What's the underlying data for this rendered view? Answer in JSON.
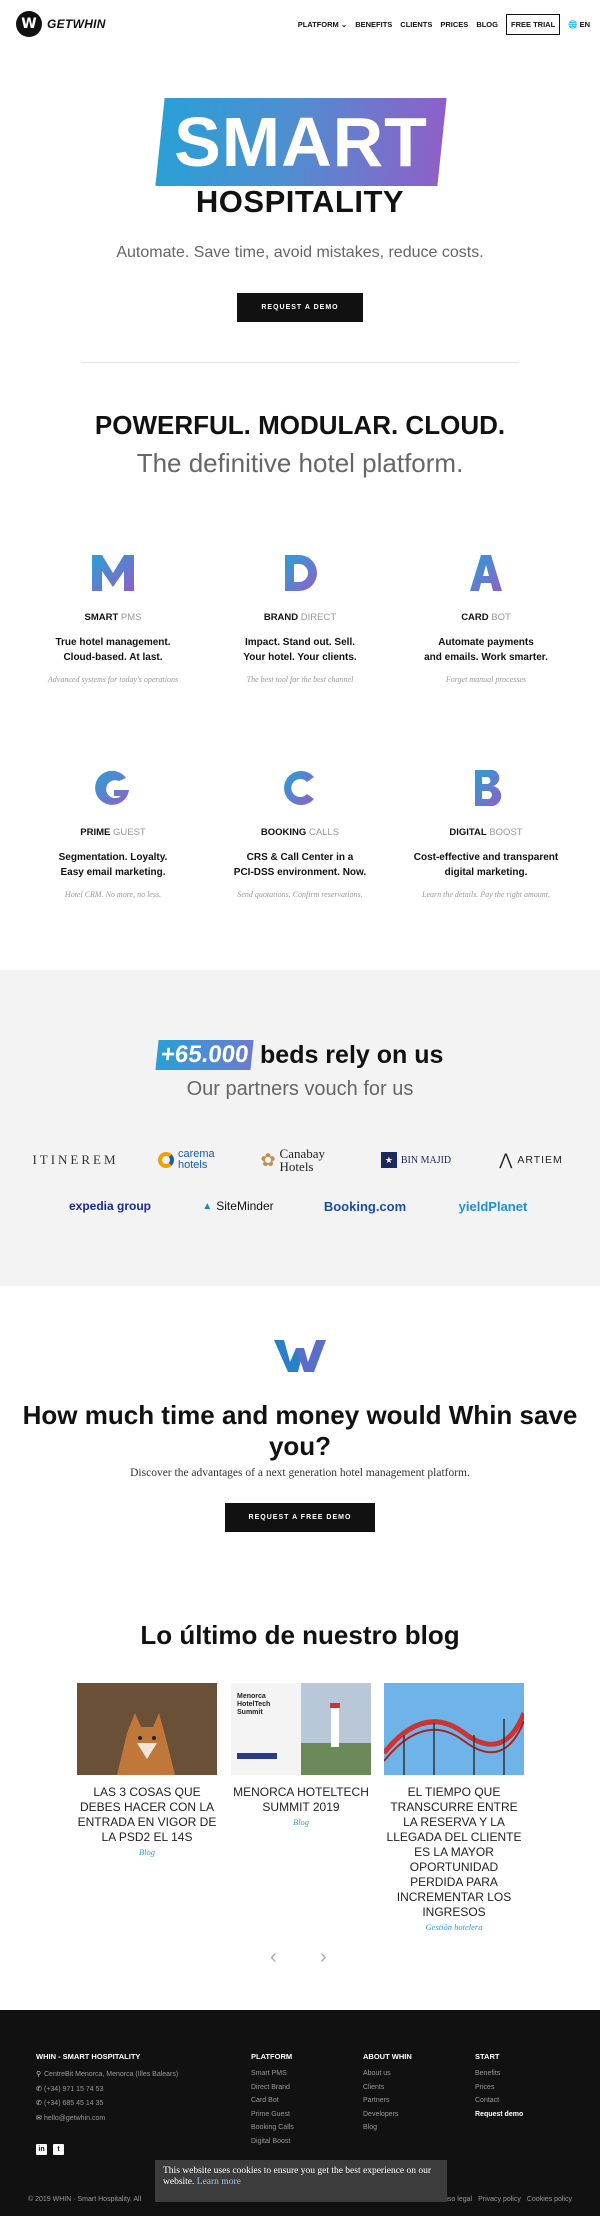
{
  "header": {
    "brand": "GETWHIN",
    "logo_letter": "W",
    "nav": [
      {
        "label": "PLATFORM ⌄"
      },
      {
        "label": "BENEFITS"
      },
      {
        "label": "CLIENTS"
      },
      {
        "label": "PRICES"
      },
      {
        "label": "BLOG"
      },
      {
        "label": "FREE TRIAL"
      },
      {
        "label": "🌐 EN"
      }
    ]
  },
  "hero": {
    "badge": "SMART",
    "title": "HOSPITALITY",
    "subtitle": "Automate. Save time, avoid mistakes, reduce costs.",
    "cta": "REQUEST A DEMO"
  },
  "platform": {
    "title": "POWERFUL. MODULAR. CLOUD.",
    "subtitle": "The definitive hotel platform."
  },
  "products": [
    {
      "letter": "M",
      "name": "SMART",
      "suffix": "PMS",
      "desc1": "True hotel management.",
      "desc2": "Cloud-based. At last.",
      "tagline": "Advanced systems for today's operations",
      "icon": "module-m-icon"
    },
    {
      "letter": "D",
      "name": "BRAND",
      "suffix": "DIRECT",
      "desc1": "Impact. Stand out. Sell.",
      "desc2": "Your hotel. Your clients.",
      "tagline": "The best tool for the best channel",
      "icon": "module-d-icon"
    },
    {
      "letter": "A",
      "name": "CARD",
      "suffix": "BOT",
      "desc1": "Automate payments",
      "desc2": "and emails. Work smarter.",
      "tagline": "Forget manual processes",
      "icon": "module-a-icon"
    },
    {
      "letter": "G",
      "name": "PRIME",
      "suffix": "GUEST",
      "desc1": "Segmentation. Loyalty.",
      "desc2": "Easy email marketing.",
      "tagline": "Hotel CRM. No more, no less.",
      "icon": "module-g-icon"
    },
    {
      "letter": "C",
      "name": "BOOKING",
      "suffix": "CALLS",
      "desc1": "CRS & Call Center in a",
      "desc2": "PCI-DSS environment. Now.",
      "tagline": "Send quotations. Confirm reservations.",
      "icon": "module-c-icon"
    },
    {
      "letter": "B",
      "name": "DIGITAL",
      "suffix": "BOOST",
      "desc1": "Cost-effective and transparent",
      "desc2": "digital marketing.",
      "tagline": "Learn the details. Pay the right amount.",
      "icon": "module-b-icon"
    }
  ],
  "partners": {
    "beds_number": "+65.000",
    "beds_text": "beds rely on us",
    "subtitle": "Our partners vouch for us",
    "logos": [
      {
        "name": "ITINEREM"
      },
      {
        "name": "carema hotels"
      },
      {
        "name": "Canabay Hotels"
      },
      {
        "name": "BIN MAJID"
      },
      {
        "name": "ARTIEM"
      },
      {
        "name": "expedia group"
      },
      {
        "name": "SiteMinder"
      },
      {
        "name": "Booking.com"
      },
      {
        "name": "yieldPlanet"
      }
    ]
  },
  "cta": {
    "title": "How much time and money would Whin save you?",
    "subtitle": "Discover the advantages of a next generation hotel management platform.",
    "button": "REQUEST A FREE DEMO"
  },
  "blog": {
    "title": "Lo último de nuestro blog",
    "posts": [
      {
        "title": "LAS 3 COSAS QUE DEBES HACER CON LA ENTRADA EN VIGOR DE LA PSD2 EL 14S",
        "category": "Blog"
      },
      {
        "title": "MENORCA HOTELTECH SUMMIT 2019",
        "category": "Blog",
        "image_text": "Menorca HotelTech Summit"
      },
      {
        "title": "EL TIEMPO QUE TRANSCURRE ENTRE LA RESERVA Y LA LLEGADA DEL CLIENTE ES LA MAYOR OPORTUNIDAD PERDIDA PARA INCREMENTAR LOS INGRESOS",
        "category": "Gestión hotelera"
      }
    ],
    "prev": "‹",
    "next": "›"
  },
  "footer": {
    "company": {
      "heading": "WHIN - SMART HOSPITALITY",
      "address": "CentreBit Menorca, Menorca (Illes Balears)",
      "phone1": "(+34) 971 15 74 53",
      "phone2": "(+34) 685 45 14 35",
      "email": "hello@getwhin.com"
    },
    "platform": {
      "heading": "PLATFORM",
      "items": [
        "Smart PMS",
        "Direct Brand",
        "Card Bot",
        "Prime Guest",
        "Booking Calls",
        "Digital Boost"
      ]
    },
    "about": {
      "heading": "ABOUT WHIN",
      "items": [
        "About us",
        "Clients",
        "Partners",
        "Developers",
        "Blog"
      ]
    },
    "start": {
      "heading": "START",
      "items": [
        "Benefits",
        "Prices",
        "Contact",
        "Request demo"
      ]
    },
    "copyright": "© 2019 WHIN · Smart Hospitality. All",
    "links": [
      "Aviso legal",
      "Privacy policy",
      "Cookies policy"
    ]
  },
  "cookie": {
    "text": "This website uses cookies to ensure you get the best experience on our website.",
    "link": "Learn more"
  },
  "colors": {
    "accent_blue": "#2a9fd6",
    "accent_purple": "#8e60c8",
    "dark": "#111111"
  }
}
